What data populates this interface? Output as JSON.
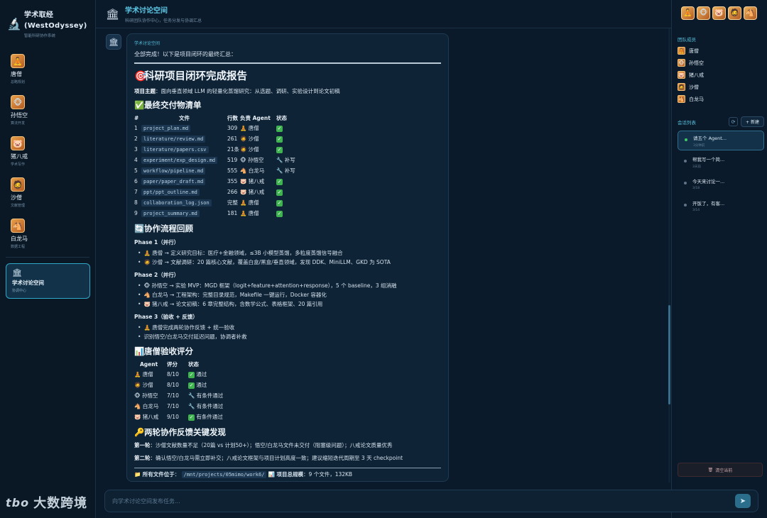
{
  "brand": {
    "title_line1": "学术取经",
    "title_line2": "(WestOdyssey)",
    "subtitle": "智能科研协作系统"
  },
  "agents": [
    {
      "name": "唐僧",
      "role": "总略规划",
      "icon": "🧘"
    },
    {
      "name": "孙悟空",
      "role": "算法开发",
      "icon": "🐵"
    },
    {
      "name": "猪八戒",
      "role": "学术写作",
      "icon": "🐷"
    },
    {
      "name": "沙僧",
      "role": "文献管理",
      "icon": "🧔"
    },
    {
      "name": "白龙马",
      "role": "数据工程",
      "icon": "🐴"
    }
  ],
  "room": {
    "name": "学术讨论空间",
    "sub": "协调中心"
  },
  "watermark": {
    "logo": "tbo",
    "text": "大数跨境"
  },
  "header": {
    "title": "学术讨论空间",
    "subtitle": "科研团队协作中心，任务分发与协调汇总"
  },
  "message": {
    "sender": "学术讨论空间",
    "intro": "全部完成！以下是项目闭环的最终汇总：",
    "report_title": "科研项目闭环完成报告",
    "topic_label": "项目主题",
    "topic_text": "：面向垂直领域 LLM 的轻量化蒸馏研究：从选题、调研、实验设计到论文初稿",
    "deliverables_title": "最终交付物清单",
    "deliverables_headers": [
      "#",
      "文件",
      "行数",
      "负责 Agent",
      "状态"
    ],
    "deliverables": [
      {
        "idx": "1",
        "file": "project_plan.md",
        "lines": "309",
        "owner": "唐僧",
        "owner_icon": "🧘",
        "status": "✓",
        "status_type": "ok"
      },
      {
        "idx": "2",
        "file": "literature/review.md",
        "lines": "261",
        "owner": "沙僧",
        "owner_icon": "🧔",
        "status": "✓",
        "status_type": "ok"
      },
      {
        "idx": "3",
        "file": "literature/papers.csv",
        "lines": "21条",
        "owner": "沙僧",
        "owner_icon": "🧔",
        "status": "✓",
        "status_type": "ok"
      },
      {
        "idx": "4",
        "file": "experiment/exp_design.md",
        "lines": "519",
        "owner": "孙悟空",
        "owner_icon": "🐵",
        "status": "🔧 补写",
        "status_type": "fix"
      },
      {
        "idx": "5",
        "file": "workflow/pipeline.md",
        "lines": "555",
        "owner": "白龙马",
        "owner_icon": "🐴",
        "status": "🔧 补写",
        "status_type": "fix"
      },
      {
        "idx": "6",
        "file": "paper/paper_draft.md",
        "lines": "355",
        "owner": "猪八戒",
        "owner_icon": "🐷",
        "status": "✓",
        "status_type": "ok"
      },
      {
        "idx": "7",
        "file": "ppt/ppt_outline.md",
        "lines": "266",
        "owner": "猪八戒",
        "owner_icon": "🐷",
        "status": "✓",
        "status_type": "ok"
      },
      {
        "idx": "8",
        "file": "collaboration_log.json",
        "lines": "完整",
        "owner": "唐僧",
        "owner_icon": "🧘",
        "status": "✓",
        "status_type": "ok"
      },
      {
        "idx": "9",
        "file": "project_summary.md",
        "lines": "181",
        "owner": "唐僧",
        "owner_icon": "🧘",
        "status": "✓",
        "status_type": "ok"
      }
    ],
    "workflow_title": "协作流程回顾",
    "phase1_title": "Phase 1（并行）",
    "phase1": [
      "🧘 唐僧 → 定义研究目标：医疗+金融领域，≤3B 小模型蒸馏，多粒度蒸馏信号融合",
      "🧔 沙僧 → 文献调研：20 篇核心文献，覆盖白盒/黑盒/垂直领域，发现 DDK、MiniLLM、GKD 为 SOTA"
    ],
    "phase2_title": "Phase 2（并行）",
    "phase2": [
      "🐵 孙悟空 → 实验 MVP：MGD 框架（logit+feature+attention+response），5 个 baseline，3 组消融",
      "🐴 白龙马 → 工程架构：完整目录规范，Makefile 一键运行，Docker 容器化",
      "🐷 猪八戒 → 论文初稿：6 章完整结构，含数学公式、表格框架、20 篇引用"
    ],
    "phase3_title": "Phase 3（验收 + 反馈）",
    "phase3": [
      "🧘 唐僧完成两轮协作反馈 + 统一验收",
      "识别悟空/白龙马交付延迟问题，协调者补救"
    ],
    "score_title": "唐僧验收评分",
    "score_headers": [
      "Agent",
      "评分",
      "状态"
    ],
    "scores": [
      {
        "agent": "唐僧",
        "icon": "🧘",
        "score": "8/10",
        "status": "✓ 通过",
        "status_type": "ok"
      },
      {
        "agent": "沙僧",
        "icon": "🧔",
        "score": "8/10",
        "status": "✓ 通过",
        "status_type": "ok"
      },
      {
        "agent": "孙悟空",
        "icon": "🐵",
        "score": "7/10",
        "status": "🔧 有条件通过",
        "status_type": "fix"
      },
      {
        "agent": "白龙马",
        "icon": "🐴",
        "score": "7/10",
        "status": "🔧 有条件通过",
        "status_type": "fix"
      },
      {
        "agent": "猪八戒",
        "icon": "🐷",
        "score": "9/10",
        "status": "✓ 有条件通过",
        "status_type": "ok"
      }
    ],
    "findings_title": "两轮协作反馈关键发现",
    "finding1_label": "第一轮",
    "finding1_text": "：沙僧文献数量不足（20篇 vs 计划50+）；悟空/白龙马文件未交付（阻塞级问题）；八戒论文质量优秀",
    "finding2_label": "第二轮",
    "finding2_text": "：确认悟空/白龙马需立即补交；八戒论文框架与项目计划高度一致；建议缩短迭代周期至 3 天 checkpoint",
    "footer_path_label": "所有文件位于",
    "footer_path": "/mnt/projects/05mimo/work6/",
    "footer_scale_label": "项目总规模",
    "footer_scale": "：9 个文件，132KB"
  },
  "input": {
    "placeholder": "向学术讨论空间发布任务..."
  },
  "right": {
    "members_title": "团队成员",
    "sessions_title": "会话列表",
    "new_label": "+ 新建",
    "sessions": [
      {
        "title": "请五个 Agent...",
        "time": "3分钟前"
      },
      {
        "title": "帮我写一个简...",
        "time": "3天前"
      },
      {
        "title": "今天来讨论一...",
        "time": "3/18"
      },
      {
        "title": "开饭了，有客...",
        "time": "3/14"
      }
    ],
    "clear_label": "清空当前"
  },
  "colors": {
    "background": "#0b1a2a",
    "accent": "#5cc8e6",
    "ok": "#3fb34f",
    "active_dot": "#3fc968"
  }
}
